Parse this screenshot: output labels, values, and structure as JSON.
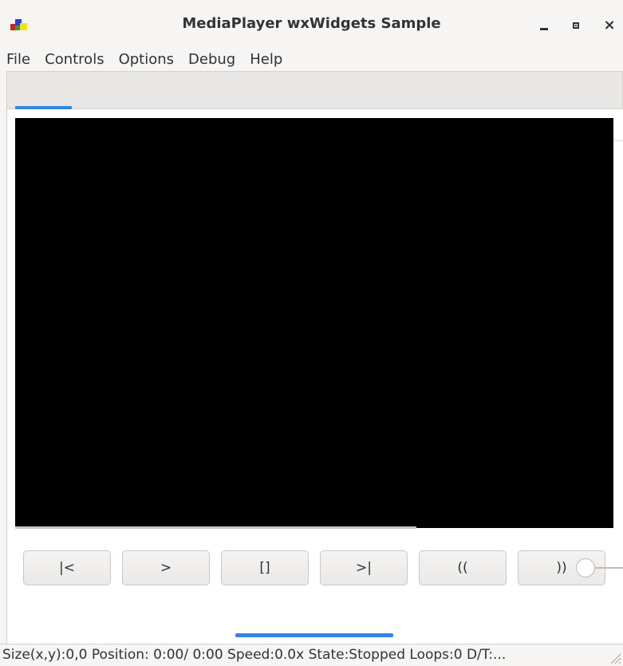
{
  "window": {
    "title": "MediaPlayer wxWidgets Sample",
    "controls": {
      "minimize": "minimize-icon",
      "maximize": "maximize-icon",
      "close": "×"
    }
  },
  "menubar": {
    "items": [
      {
        "label": "File"
      },
      {
        "label": "Controls"
      },
      {
        "label": "Options"
      },
      {
        "label": "Debug"
      },
      {
        "label": "Help"
      }
    ]
  },
  "controls": {
    "prev_label": "|<",
    "play_label": ">",
    "stop_label": "[]",
    "next_label": ">|",
    "vol_down_label": "((",
    "vol_up_label": "))"
  },
  "statusbar": {
    "text": "Size(x,y):0,0 Position: 0:00/ 0:00 Speed:0.0x State:Stopped Loops:0 D/T:..."
  },
  "colors": {
    "accent": "#3584e4",
    "video_bg": "#000000",
    "window_bg": "#f6f5f4"
  }
}
